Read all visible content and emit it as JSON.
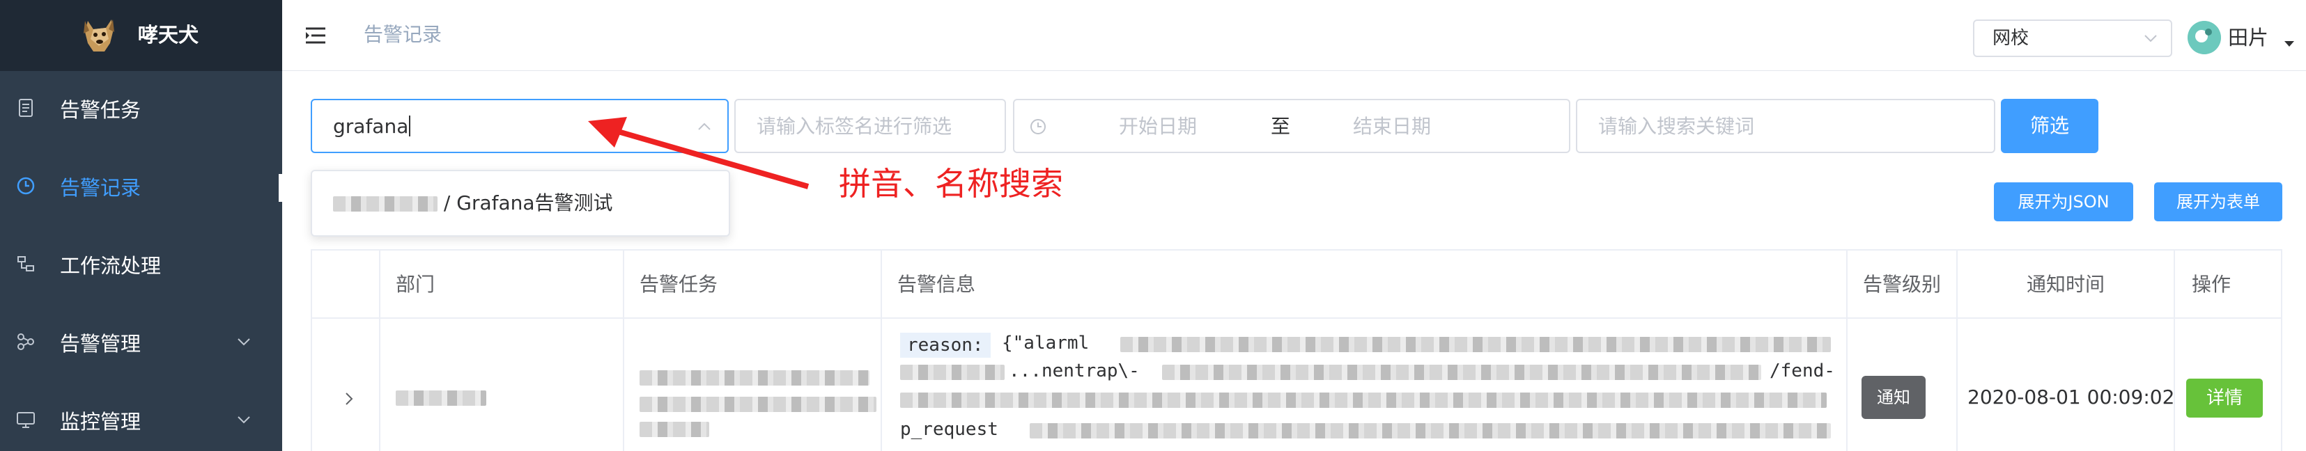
{
  "brand": {
    "name": "哮天犬",
    "logo_icon": "dog-logo-icon"
  },
  "sidebar": {
    "items": [
      {
        "label": "告警任务",
        "icon": "document-icon",
        "active": false
      },
      {
        "label": "告警记录",
        "icon": "clock-icon",
        "active": true
      },
      {
        "label": "工作流处理",
        "icon": "workflow-icon",
        "active": false
      },
      {
        "label": "告警管理",
        "icon": "nodes-icon",
        "active": false,
        "expandable": true
      },
      {
        "label": "监控管理",
        "icon": "monitor-icon",
        "active": false,
        "expandable": true
      }
    ],
    "active_color": "#409eff",
    "background": "#2f3d4c"
  },
  "header": {
    "breadcrumb": "告警记录",
    "org_select": {
      "value": "网校"
    },
    "user": {
      "name": "田片"
    }
  },
  "filters": {
    "search_value": "grafana",
    "tag_placeholder": "请输入标签名进行筛选",
    "date_start_placeholder": "开始日期",
    "date_separator": "至",
    "date_end_placeholder": "结束日期",
    "keyword_placeholder": "请输入搜索关键词",
    "filter_button": "筛选"
  },
  "dropdown": {
    "suggestion_suffix": "/ Grafana告警测试"
  },
  "annotation": {
    "text": "拼音、名称搜索",
    "color": "#ee2222"
  },
  "toolbar": {
    "expand_json": "展开为JSON",
    "expand_form": "展开为表单"
  },
  "table": {
    "columns": [
      "部门",
      "告警任务",
      "告警信息",
      "告警级别",
      "通知时间",
      "操作"
    ],
    "rows": [
      {
        "reason_label": "reason:",
        "message_lines": [
          "{\"alarml",
          "...nentrap\\-",
          "/fend-",
          "p_request"
        ],
        "level": "通知",
        "time": "2020-08-01 00:09:02",
        "action": "详情"
      }
    ]
  },
  "colors": {
    "primary": "#409eff",
    "success": "#67c23a",
    "level_tag": "#606266"
  }
}
